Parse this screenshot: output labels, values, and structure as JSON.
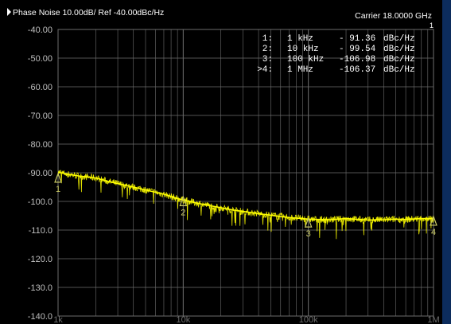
{
  "header": {
    "title": "Phase Noise 10.00dB/ Ref -40.00dBc/Hz",
    "carrier": "Carrier 18.0000 GHz",
    "corner_marker": "1"
  },
  "marker_table": [
    {
      "label": "1:",
      "freq": "1 kHz",
      "value": "- 91.36",
      "unit": "dBc/Hz"
    },
    {
      "label": "2:",
      "freq": "10 kHz",
      "value": "- 99.54",
      "unit": "dBc/Hz"
    },
    {
      "label": "3:",
      "freq": "100 kHz",
      "value": "-106.98",
      "unit": "dBc/Hz"
    },
    {
      "label": ">4:",
      "freq": "1 MHz",
      "value": "-106.37",
      "unit": "dBc/Hz"
    }
  ],
  "colors": {
    "trace": "#ffff00",
    "grid": "#6e6e6e",
    "text": "#ffffff",
    "tick_text": "#bfbfbf",
    "marker": "#c8c864"
  },
  "chart_data": {
    "type": "line",
    "title": "Phase Noise 10.00dB/ Ref -40.00dBc/Hz",
    "xscale": "log",
    "xlim": [
      1000,
      1000000
    ],
    "ylim": [
      -140,
      -40
    ],
    "yticks": [
      -40,
      -50,
      -60,
      -70,
      -80,
      -90,
      -100,
      -110,
      -120,
      -130,
      -140
    ],
    "ytick_labels": [
      "-40.00",
      "-50.00",
      "-60.00",
      "-70.00",
      "-80.00",
      "-90.00",
      "-100.0",
      "-110.0",
      "-120.0",
      "-130.0",
      "-140.0"
    ],
    "xtick_labels": [
      "1k",
      "10k",
      "100k",
      "1M"
    ],
    "xticks": [
      1000,
      10000,
      100000,
      1000000
    ],
    "grid": true,
    "series": [
      {
        "x": [
          1000,
          1200,
          1500,
          2000,
          2500,
          3000,
          4000,
          5000,
          6000,
          7000,
          8000,
          9000,
          10000,
          12000,
          15000,
          20000,
          25000,
          30000,
          40000,
          50000,
          60000,
          70000,
          80000,
          100000,
          150000,
          200000,
          300000,
          400000,
          500000,
          600000,
          800000,
          1000000
        ],
        "y": [
          -89.8,
          -90.5,
          -91.2,
          -91.8,
          -93.0,
          -93.8,
          -95.0,
          -96.0,
          -96.8,
          -97.5,
          -98.3,
          -99.0,
          -99.5,
          -100.3,
          -101.2,
          -102.2,
          -103.0,
          -103.5,
          -104.3,
          -104.8,
          -105.3,
          -105.6,
          -105.8,
          -106.2,
          -106.4,
          -106.0,
          -106.5,
          -106.4,
          -106.2,
          -106.3,
          -106.0,
          -106.0
        ]
      }
    ],
    "markers": [
      {
        "id": "1",
        "x": 1000,
        "y": -91.36
      },
      {
        "id": "2",
        "x": 10000,
        "y": -99.54
      },
      {
        "id": "3",
        "x": 100000,
        "y": -106.98
      },
      {
        "id": "4",
        "x": 1000000,
        "y": -106.37
      }
    ]
  }
}
